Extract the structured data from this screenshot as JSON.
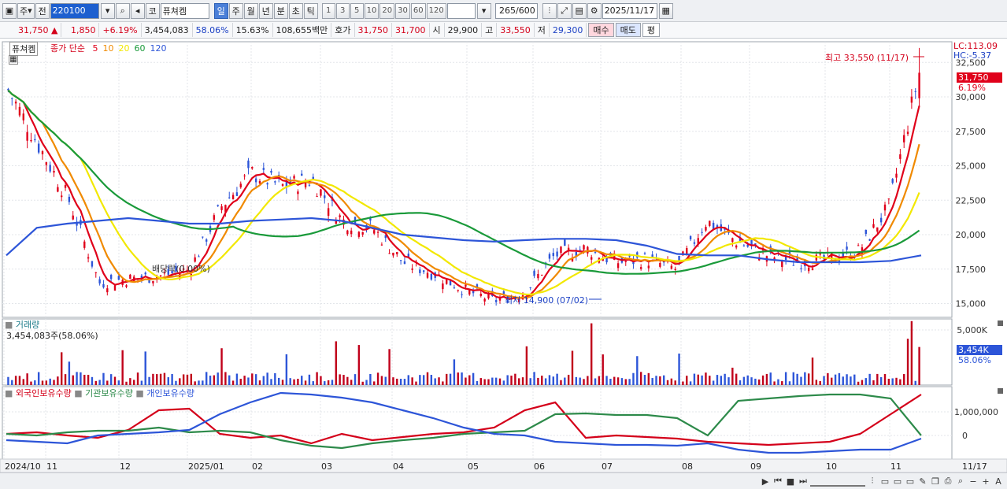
{
  "toolbar": {
    "period_label": "주",
    "prev_label": "전",
    "stock_code": "220100",
    "code_prefix": "코",
    "stock_name": "퓨쳐켐",
    "timeframes": [
      "일",
      "주",
      "월",
      "년",
      "분",
      "초",
      "틱"
    ],
    "active_timeframe": "일",
    "intervals": [
      "1",
      "3",
      "5",
      "10",
      "20",
      "30",
      "60",
      "120"
    ],
    "count": "265",
    "count_max": "/600",
    "date": "2025/11/17"
  },
  "quote": {
    "price": "31,750",
    "arrow": "▲",
    "change": "1,850",
    "change_pct": "+6.19%",
    "volume": "3,454,083",
    "vol_ratio": "58.06%",
    "turnover": "15.63%",
    "amount": "108,655백만",
    "hoga_label": "호가",
    "ask": "31,750",
    "bid": "31,700",
    "open_label": "시",
    "open": "29,900",
    "high_label": "고",
    "high": "33,550",
    "low_label": "저",
    "low": "29,300",
    "buy_label": "매수",
    "sell_label": "매도",
    "eval_label": "평"
  },
  "price_panel": {
    "name_tag": "퓨쳐켐",
    "legend_prefix": "종가 단순",
    "ma_periods": [
      "5",
      "10",
      "20",
      "60",
      "120"
    ],
    "ma_colors": [
      "#e0001a",
      "#f08a00",
      "#f2e800",
      "#1a9a3a",
      "#2d55d8"
    ],
    "lc": "LC:113.09",
    "hc": "HC:-5.37",
    "y_ticks": [
      "32,500",
      "30,000",
      "27,500",
      "25,000",
      "22,500",
      "20,000",
      "17,500",
      "15,000"
    ],
    "current_price": "31,750",
    "current_pct": "6.19%",
    "high_annotation": "최고 33,550 (11/17)",
    "low_annotation": "최저 14,900 (07/02)",
    "dividend_annotation": "배당락(0.00%)"
  },
  "volume_panel": {
    "title": "거래량",
    "value": "3,454,083주(58.06%)",
    "y_ticks": [
      "5,000K"
    ],
    "current": "3,454K",
    "current_pct": "58.06%"
  },
  "holdings_panel": {
    "series": [
      "외국인보유수량",
      "기관보유수량",
      "개인보유수량"
    ],
    "colors": [
      "#d4001a",
      "#2d8a4a",
      "#2d55d8"
    ],
    "y_ticks": [
      "1,000,000",
      "0"
    ]
  },
  "x_axis": {
    "labels": [
      "2024/10",
      "11",
      "12",
      "2025/01",
      "02",
      "03",
      "04",
      "05",
      "06",
      "07",
      "08",
      "09",
      "10",
      "11"
    ],
    "last_date": "11/17"
  },
  "chart_data": {
    "type": "line",
    "title": "퓨쳐켐 220100",
    "x_labels": [
      "2024/10",
      "11",
      "12",
      "2025/01",
      "02",
      "03",
      "04",
      "05",
      "06",
      "07",
      "08",
      "09",
      "10",
      "11"
    ],
    "price_ylim": [
      14000,
      34000
    ],
    "series": [
      {
        "name": "종가",
        "values": [
          30500,
          26500,
          22500,
          16500,
          16800,
          17000,
          17500,
          22000,
          24500,
          23500,
          24000,
          21000,
          20500,
          18000,
          17200,
          16000,
          15200,
          15800,
          18500,
          19000,
          18000,
          18200,
          17500,
          21000,
          19500,
          18500,
          18000,
          18200,
          18800,
          22000,
          31750
        ]
      },
      {
        "name": "5",
        "values": [
          30000,
          27000,
          23000,
          17000,
          16800,
          17000,
          17600,
          21500,
          24300,
          23600,
          23800,
          21500,
          20500,
          18300,
          17300,
          16200,
          15400,
          15900,
          18300,
          18800,
          18200,
          18100,
          17700,
          20500,
          19800,
          18600,
          18200,
          18300,
          18800,
          21000,
          26500
        ]
      },
      {
        "name": "120",
        "values": [
          18500,
          20500,
          20800,
          21000,
          21200,
          21000,
          20800,
          20800,
          21000,
          21100,
          21200,
          21000,
          20500,
          20000,
          19800,
          19600,
          19500,
          19600,
          19700,
          19700,
          19600,
          19200,
          18600,
          18500,
          18500,
          18200,
          18000,
          18000,
          18000,
          18100,
          18500
        ]
      }
    ],
    "low": 14900,
    "high": 33550,
    "volume_ylim": [
      0,
      6000
    ],
    "volume_unit": "K"
  }
}
